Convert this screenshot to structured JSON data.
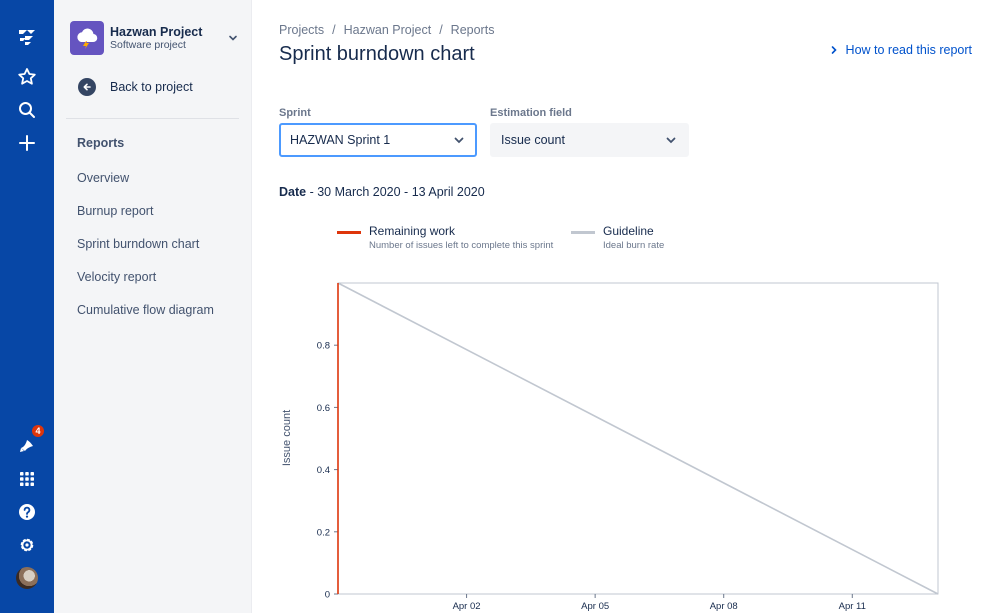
{
  "nav": {
    "notification_count": "4"
  },
  "project": {
    "name": "Hazwan Project",
    "type": "Software project"
  },
  "sidebar": {
    "back_label": "Back to project",
    "section_title": "Reports",
    "items": [
      {
        "label": "Overview"
      },
      {
        "label": "Burnup report"
      },
      {
        "label": "Sprint burndown chart"
      },
      {
        "label": "Velocity report"
      },
      {
        "label": "Cumulative flow diagram"
      }
    ]
  },
  "breadcrumbs": [
    "Projects",
    "Hazwan Project",
    "Reports"
  ],
  "page": {
    "title": "Sprint burndown chart",
    "help_link": "How to read this report"
  },
  "filters": {
    "sprint_label": "Sprint",
    "sprint_value": "HAZWAN Sprint 1",
    "estimation_label": "Estimation field",
    "estimation_value": "Issue count"
  },
  "date": {
    "label": "Date",
    "range": " - 30 March 2020 - 13 April 2020"
  },
  "legend": [
    {
      "name": "Remaining work",
      "description": "Number of issues left to complete this sprint",
      "color": "#de350b"
    },
    {
      "name": "Guideline",
      "description": "Ideal burn rate",
      "color": "#c1c7d0"
    }
  ],
  "chart_data": {
    "type": "line",
    "ylabel": "Issue count",
    "ylim": [
      0,
      1
    ],
    "yticks": [
      0,
      0.2,
      0.4,
      0.6,
      0.8
    ],
    "xlim": [
      "2020-03-30",
      "2020-04-13"
    ],
    "xticks": [
      {
        "date": "2020-04-02",
        "label": "Apr 02"
      },
      {
        "date": "2020-04-05",
        "label": "Apr 05"
      },
      {
        "date": "2020-04-08",
        "label": "Apr 08"
      },
      {
        "date": "2020-04-11",
        "label": "Apr 11"
      }
    ],
    "series": [
      {
        "name": "Remaining work",
        "color": "#de350b",
        "points": [
          {
            "x": "2020-03-30",
            "y": 0
          },
          {
            "x": "2020-03-30",
            "y": 1
          }
        ]
      },
      {
        "name": "Guideline",
        "color": "#c1c7d0",
        "points": [
          {
            "x": "2020-03-30",
            "y": 1
          },
          {
            "x": "2020-04-13",
            "y": 0
          }
        ]
      }
    ]
  }
}
